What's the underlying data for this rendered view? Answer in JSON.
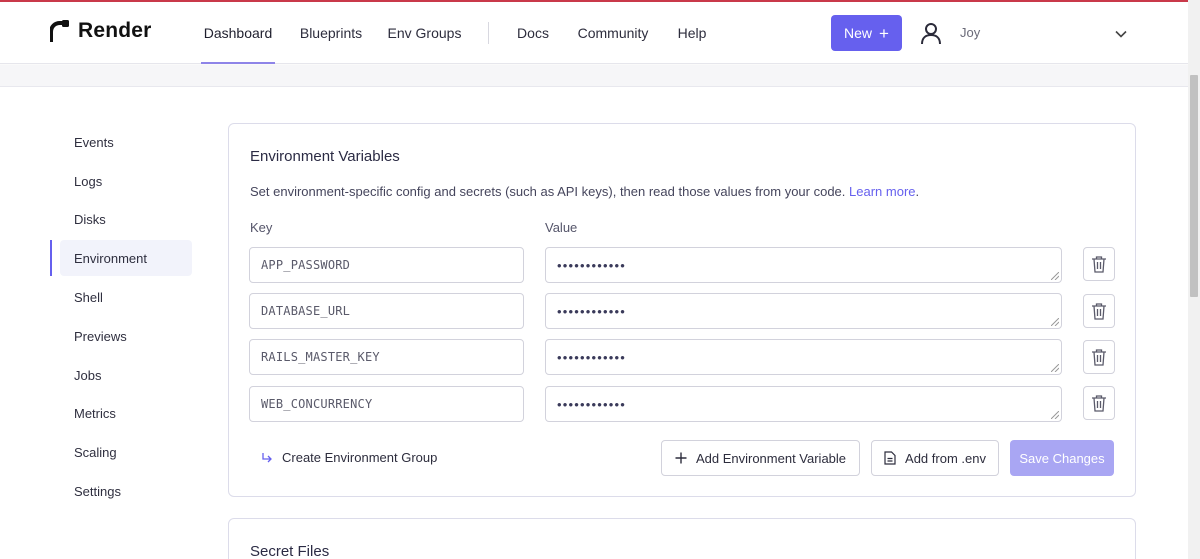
{
  "brand": {
    "name": "Render"
  },
  "nav": {
    "items": [
      {
        "label": "Dashboard",
        "active": true
      },
      {
        "label": "Blueprints"
      },
      {
        "label": "Env Groups"
      },
      {
        "label": "Docs"
      },
      {
        "label": "Community"
      },
      {
        "label": "Help"
      }
    ]
  },
  "header": {
    "new_button": {
      "label": "New",
      "icon": "plus-icon"
    },
    "user": {
      "name": "Joy",
      "avatar_icon": "user-icon"
    }
  },
  "sidebar": {
    "items": [
      {
        "label": "Events"
      },
      {
        "label": "Logs"
      },
      {
        "label": "Disks"
      },
      {
        "label": "Environment",
        "active": true
      },
      {
        "label": "Shell"
      },
      {
        "label": "Previews"
      },
      {
        "label": "Jobs"
      },
      {
        "label": "Metrics"
      },
      {
        "label": "Scaling"
      },
      {
        "label": "Settings"
      }
    ]
  },
  "env": {
    "title": "Environment Variables",
    "description": "Set environment-specific config and secrets (such as API keys), then read those values from your code.",
    "learn_more": "Learn more",
    "description_end": ".",
    "key_label": "Key",
    "value_label": "Value",
    "variables": [
      {
        "key": "APP_PASSWORD",
        "value": "••••••••••••"
      },
      {
        "key": "DATABASE_URL",
        "value": "••••••••••••"
      },
      {
        "key": "RAILS_MASTER_KEY",
        "value": "••••••••••••"
      },
      {
        "key": "WEB_CONCURRENCY",
        "value": "••••••••••••"
      }
    ],
    "create_group": "Create Environment Group",
    "add_variable": "Add Environment Variable",
    "add_from_env": "Add from .env",
    "save": "Save Changes"
  },
  "secret_files": {
    "title": "Secret Files"
  },
  "colors": {
    "accent": "#6660ee",
    "accent_disabled": "#a9a6f3",
    "nav_underline": "#8e84e8"
  }
}
